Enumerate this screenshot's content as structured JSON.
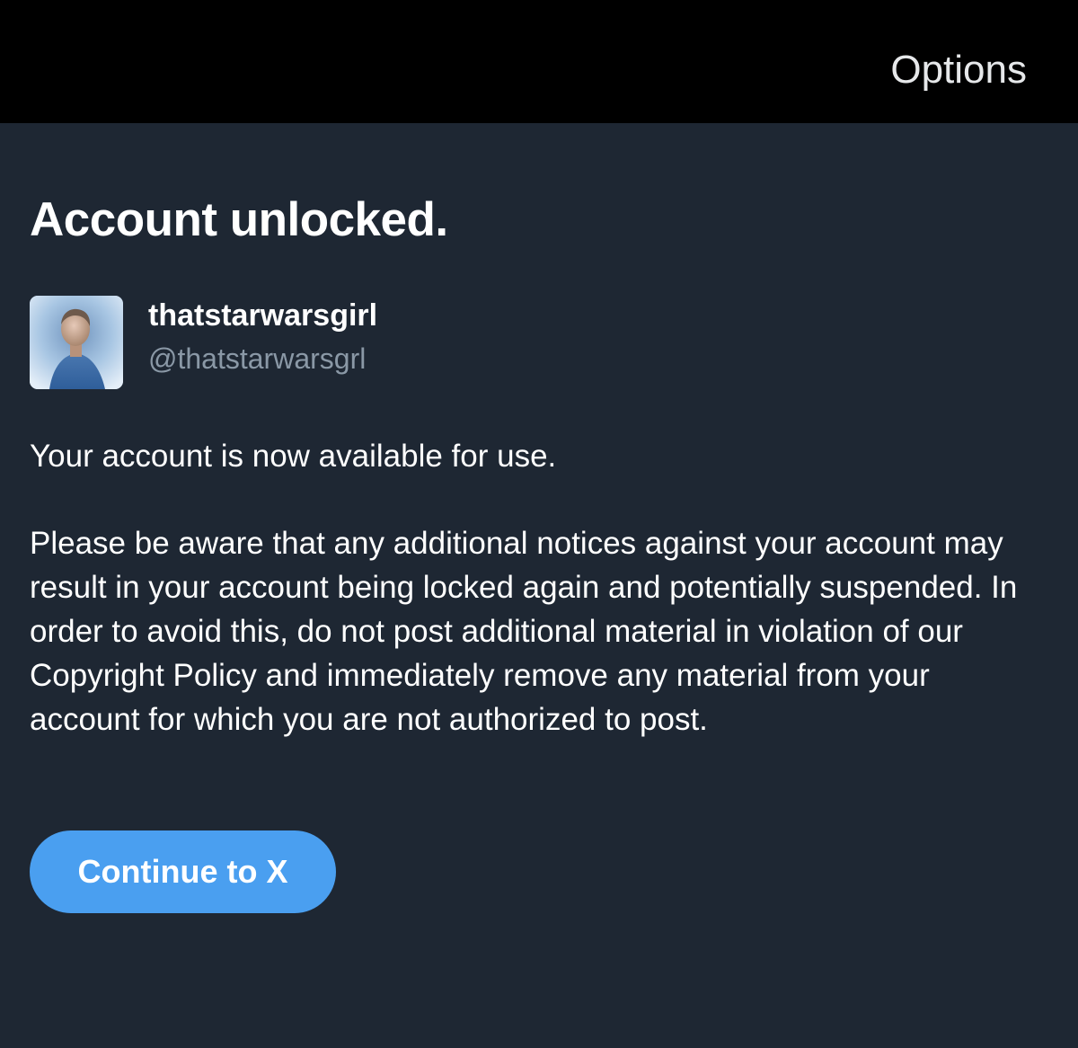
{
  "header": {
    "options_label": "Options"
  },
  "main": {
    "title": "Account unlocked.",
    "account": {
      "display_name": "thatstarwarsgirl",
      "handle": "@thatstarwarsgrl",
      "avatar_icon": "profile-photo"
    },
    "message_1": "Your account is now available for use.",
    "message_2": "Please be aware that any additional notices against your account may result in your account being locked again and potentially suspended. In order to avoid this, do not post additional material in violation of our Copyright Policy and immediately remove any material from your account for which you are not authorized to post.",
    "continue_label": "Continue to X"
  },
  "colors": {
    "header_bg": "#000000",
    "page_bg": "#1e2733",
    "primary_text": "#ffffff",
    "secondary_text": "#8a98a6",
    "accent": "#4a9ff0"
  }
}
